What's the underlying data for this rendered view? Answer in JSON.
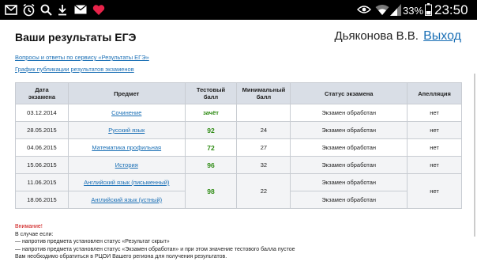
{
  "status_bar": {
    "icons_left": [
      "email-icon",
      "alarm-icon",
      "search-icon",
      "download-icon",
      "mail-icon",
      "heart-icon"
    ],
    "icons_right": [
      "eye-icon",
      "wifi-icon",
      "signal-icon",
      "battery-icon"
    ],
    "battery_percent": "33%",
    "time": "23:50"
  },
  "header": {
    "title": "Ваши результаты ЕГЭ",
    "user_name": "Дьяконова В.В.",
    "logout_label": "Выход"
  },
  "links": {
    "faq": "Вопросы и ответы по сервису «Результаты ЕГЭ»",
    "schedule": "График публикации результатов экзаменов"
  },
  "table": {
    "headers": {
      "date": [
        "Дата",
        "экзамена"
      ],
      "subject": "Предмет",
      "test_score": [
        "Тестовый",
        "балл"
      ],
      "min_score": [
        "Минимальный",
        "балл"
      ],
      "status": "Статус экзамена",
      "appeal": "Апелляция"
    },
    "rows": [
      {
        "date": "03.12.2014",
        "subject": "Сочинение",
        "score": "зачёт",
        "min": "",
        "status": "Экзамен обработан",
        "appeal": "нет"
      },
      {
        "date": "28.05.2015",
        "subject": "Русский язык",
        "score": "92",
        "min": "24",
        "status": "Экзамен обработан",
        "appeal": "нет"
      },
      {
        "date": "04.06.2015",
        "subject": "Математика профильная",
        "score": "72",
        "min": "27",
        "status": "Экзамен обработан",
        "appeal": "нет"
      },
      {
        "date": "15.06.2015",
        "subject": "История",
        "score": "96",
        "min": "32",
        "status": "Экзамен обработан",
        "appeal": "нет"
      }
    ],
    "group": {
      "score": "98",
      "min": "22",
      "appeal": "нет",
      "rows": [
        {
          "date": "11.06.2015",
          "subject": "Английский язык (письменный)",
          "status": "Экзамен обработан"
        },
        {
          "date": "18.06.2015",
          "subject": "Английский язык (устный)",
          "status": "Экзамен обработан"
        }
      ]
    }
  },
  "notes": {
    "warning": "Внимание!",
    "lines": [
      "В случае если:",
      "— напротив предмета установлен статус «Результат скрыт»",
      "— напротив предмета установлен статус «Экзамен обработан» и при этом значение тестового балла пустое",
      "Вам необходимо обратиться в РЦОИ Вашего региона для получения результатов."
    ]
  }
}
